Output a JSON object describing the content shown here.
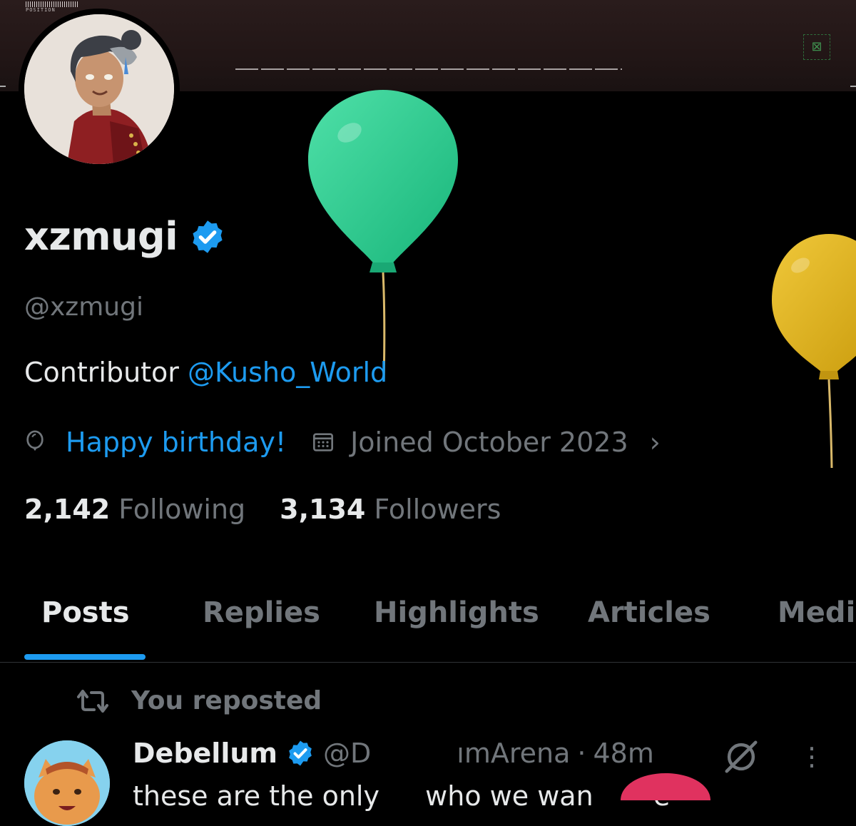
{
  "banner": {
    "position_label": "POSITION"
  },
  "profile": {
    "display_name": "xzmugi",
    "handle": "@xzmugi",
    "bio_prefix": "Contributor ",
    "bio_mention": "@Kusho_World",
    "birthday_text": "Happy birthday!",
    "joined_text": "Joined October 2023",
    "following_count": "2,142",
    "following_label": "Following",
    "followers_count": "3,134",
    "followers_label": "Followers"
  },
  "tabs": [
    {
      "label": "Posts",
      "active": true
    },
    {
      "label": "Replies",
      "active": false
    },
    {
      "label": "Highlights",
      "active": false
    },
    {
      "label": "Articles",
      "active": false
    },
    {
      "label": "Medi",
      "active": false
    }
  ],
  "post": {
    "repost_label": "You reposted",
    "author_name": "Debellum",
    "author_handle_start": "@D",
    "author_handle_end": "ımArena",
    "separator": "·",
    "time": "48m",
    "text_start": "these are the only",
    "text_mid": "who we wan",
    "text_end": "e"
  },
  "colors": {
    "accent": "#1d9bf0",
    "balloon_green": "#2fd291",
    "balloon_yellow": "#e3b51b",
    "balloon_pink": "#e0325f"
  },
  "icons": {
    "verified": "verified-badge-icon",
    "birthday": "balloon-icon",
    "joined": "calendar-icon",
    "chevron": "chevron-right-icon",
    "repost": "repost-icon",
    "grok": "grok-icon",
    "more": "more-icon"
  }
}
